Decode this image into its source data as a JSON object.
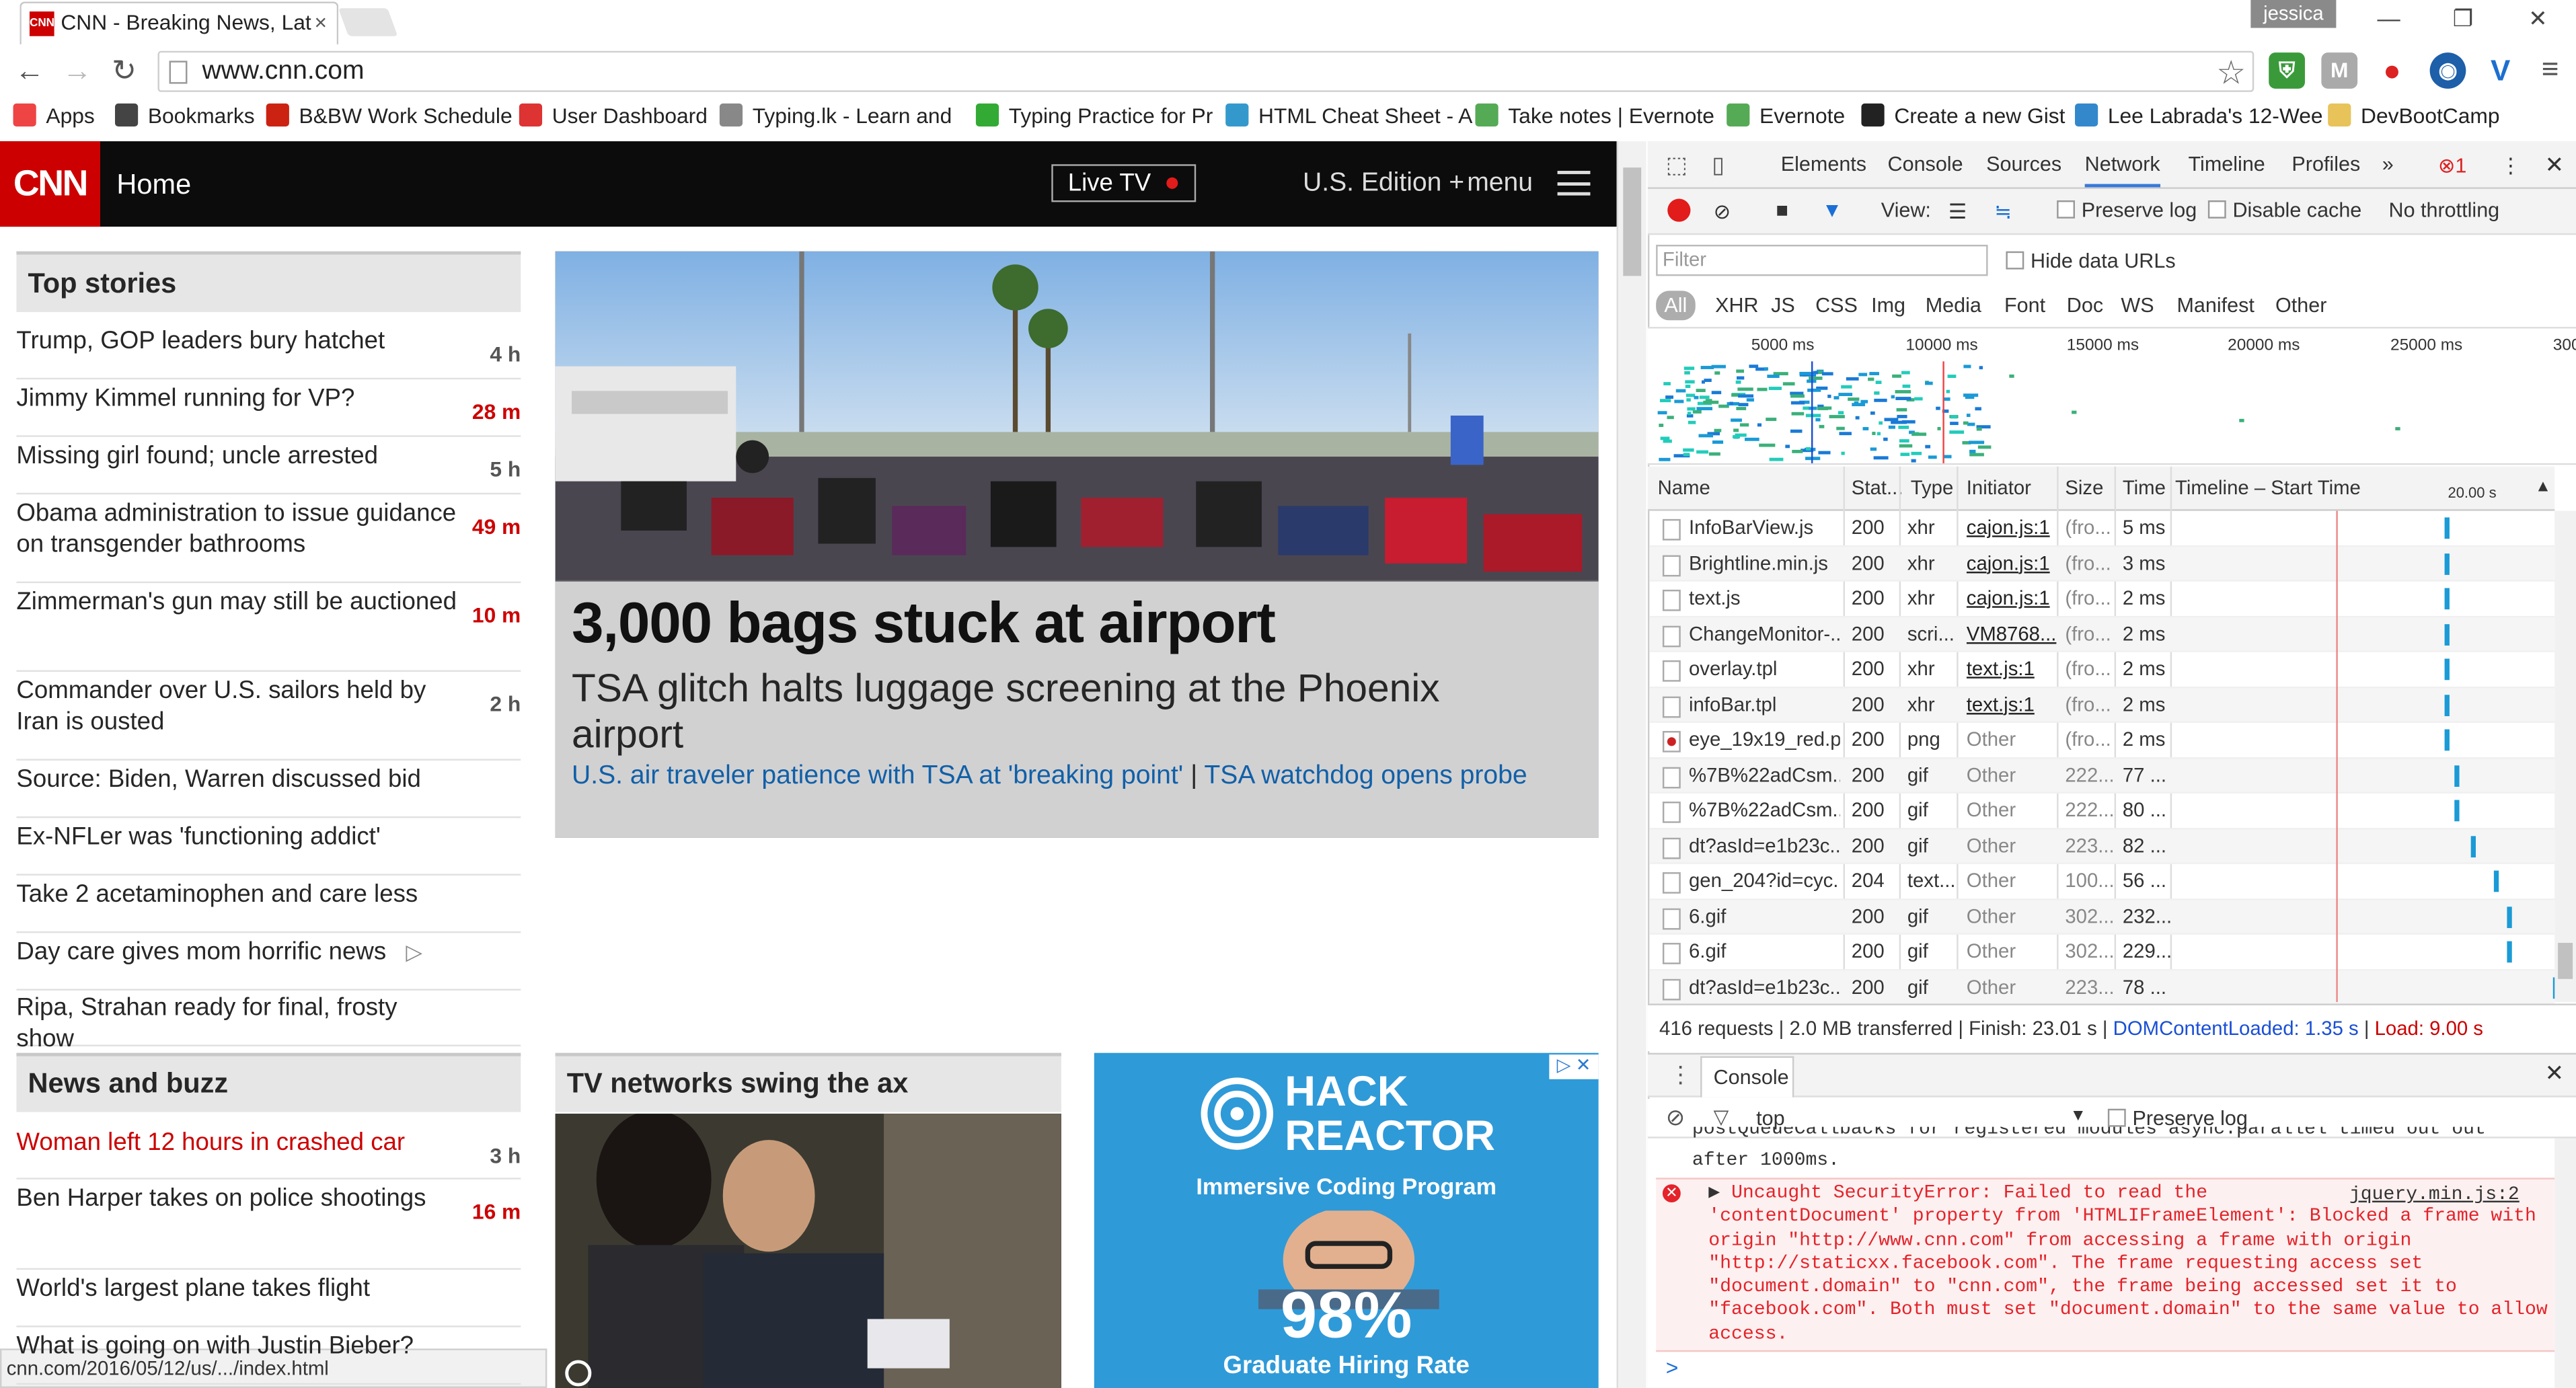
{
  "browser": {
    "tab_title": "CNN - Breaking News, Lat",
    "tab_favicon": "CNN",
    "profile": "jessica",
    "url": "www.cnn.com",
    "status_url": "cnn.com/2016/05/12/us/.../index.html"
  },
  "bookmarks": [
    {
      "label": "Apps",
      "icon": "apps-grid-icon",
      "color": "#e44"
    },
    {
      "label": "Bookmarks",
      "icon": "star-icon",
      "color": "#444"
    },
    {
      "label": "B&BW Work Schedule",
      "icon": "calendar-icon",
      "color": "#c21"
    },
    {
      "label": "User Dashboard",
      "icon": "dashboard-icon",
      "color": "#d33"
    },
    {
      "label": "Typing.lk - Learn and",
      "icon": "keyboard-icon",
      "color": "#888"
    },
    {
      "label": "Typing Practice for Pr",
      "icon": "t-icon",
      "color": "#3a3"
    },
    {
      "label": "HTML Cheat Sheet - A",
      "icon": "code-icon",
      "color": "#39c"
    },
    {
      "label": "Take notes | Evernote",
      "icon": "evernote-icon",
      "color": "#5a5"
    },
    {
      "label": "Evernote",
      "icon": "evernote-icon",
      "color": "#5a5"
    },
    {
      "label": "Create a new Gist",
      "icon": "github-icon",
      "color": "#222"
    },
    {
      "label": "Lee Labrada's 12-Wee",
      "icon": "bookmark-icon",
      "color": "#38c"
    },
    {
      "label": "DevBootCamp",
      "icon": "folder-icon",
      "color": "#e8c35a"
    }
  ],
  "cnn": {
    "logo": "CNN",
    "home": "Home",
    "live_tv": "Live TV",
    "edition": "U.S. Edition +",
    "menu": "menu",
    "top_stories_title": "Top stories",
    "top_stories": [
      {
        "title": "Trump, GOP leaders bury hatchet",
        "time": "4 h",
        "red": false
      },
      {
        "title": "Jimmy Kimmel running for VP?",
        "time": "28 m",
        "red": true
      },
      {
        "title": "Missing girl found; uncle arrested",
        "time": "5 h",
        "red": false
      },
      {
        "title": "Obama administration to issue guidance on transgender bathrooms",
        "time": "49 m",
        "red": true
      },
      {
        "title": "Zimmerman's gun may still be auctioned",
        "time": "10 m",
        "red": true
      },
      {
        "title": "Commander over U.S. sailors held by Iran is ousted",
        "time": "2 h",
        "red": false
      },
      {
        "title": "Source: Biden, Warren discussed bid",
        "time": "",
        "red": false
      },
      {
        "title": "Ex-NFLer was 'functioning addict'",
        "time": "",
        "red": false
      },
      {
        "title": "Take 2 acetaminophen and care less",
        "time": "",
        "red": false
      },
      {
        "title": "Day care gives mom horrific news",
        "time": "",
        "red": false
      },
      {
        "title": "Ripa, Strahan ready for final, frosty show",
        "time": "",
        "red": false
      }
    ],
    "hero": {
      "headline": "3,000 bags stuck at airport",
      "subhead": "TSA glitch halts luggage screening at the Phoenix airport",
      "link1": "U.S. air traveler patience with TSA at 'breaking point'",
      "separator": " | ",
      "link2": "TSA watchdog opens probe"
    },
    "news_buzz_title": "News and buzz",
    "news_buzz": [
      {
        "title": "Woman left 12 hours in crashed car",
        "time": "3 h",
        "red": false,
        "title_red": true
      },
      {
        "title": "Ben Harper takes on police shootings",
        "time": "16 m",
        "red": true,
        "title_red": false
      },
      {
        "title": "World's largest plane takes flight",
        "time": "",
        "red": false,
        "title_red": false
      },
      {
        "title": "What is going on with Justin Bieber?",
        "time": "",
        "red": false,
        "title_red": false
      }
    ],
    "tv_section": "TV networks swing the ax",
    "ad": {
      "brand1": "HACK",
      "brand2": "REACTOR",
      "line": "Immersive Coding Program",
      "percent": "98%",
      "bottom": "Graduate Hiring Rate"
    }
  },
  "devtools": {
    "tabs": [
      "Elements",
      "Console",
      "Sources",
      "Network",
      "Timeline",
      "Profiles"
    ],
    "active_tab": "Network",
    "more": "»",
    "error_count": "1",
    "toolbar": {
      "view": "View:",
      "preserve_log": "Preserve log",
      "disable_cache": "Disable cache",
      "throttling": "No throttling"
    },
    "filter_placeholder": "Filter",
    "hide_data_urls": "Hide data URLs",
    "filter_types": [
      "All",
      "XHR",
      "JS",
      "CSS",
      "Img",
      "Media",
      "Font",
      "Doc",
      "WS",
      "Manifest",
      "Other"
    ],
    "overview_ticks": [
      "5000 ms",
      "10000 ms",
      "15000 ms",
      "20000 ms",
      "25000 ms",
      "300"
    ],
    "columns": {
      "name": "Name",
      "status": "Stat...",
      "type": "Type",
      "initiator": "Initiator",
      "size": "Size",
      "time": "Time",
      "timeline": "Timeline – Start Time",
      "timeline_tick": "20.00 s"
    },
    "requests": [
      {
        "name": "InfoBarView.js",
        "status": "200",
        "type": "xhr",
        "initiator": "cajon.js:1",
        "link": true,
        "size": "(fro...",
        "time": "5 ms",
        "start": 0.55
      },
      {
        "name": "Brightline.min.js",
        "status": "200",
        "type": "xhr",
        "initiator": "cajon.js:1",
        "link": true,
        "size": "(fro...",
        "time": "3 ms",
        "start": 0.55
      },
      {
        "name": "text.js",
        "status": "200",
        "type": "xhr",
        "initiator": "cajon.js:1",
        "link": true,
        "size": "(fro...",
        "time": "2 ms",
        "start": 0.55
      },
      {
        "name": "ChangeMonitor-...",
        "status": "200",
        "type": "scri...",
        "initiator": "VM8768...",
        "link": true,
        "size": "(fro...",
        "time": "2 ms",
        "start": 0.55
      },
      {
        "name": "overlay.tpl",
        "status": "200",
        "type": "xhr",
        "initiator": "text.js:1",
        "link": true,
        "size": "(fro...",
        "time": "2 ms",
        "start": 0.55
      },
      {
        "name": "infoBar.tpl",
        "status": "200",
        "type": "xhr",
        "initiator": "text.js:1",
        "link": true,
        "size": "(fro...",
        "time": "2 ms",
        "start": 0.55
      },
      {
        "name": "eye_19x19_red.p...",
        "status": "200",
        "type": "png",
        "initiator": "Other",
        "link": false,
        "size": "(fro...",
        "time": "2 ms",
        "start": 0.55
      },
      {
        "name": "%7B%22adCsm...",
        "status": "200",
        "type": "gif",
        "initiator": "Other",
        "link": false,
        "size": "222...",
        "time": "77 ...",
        "start": 0.6
      },
      {
        "name": "%7B%22adCsm...",
        "status": "200",
        "type": "gif",
        "initiator": "Other",
        "link": false,
        "size": "222...",
        "time": "80 ...",
        "start": 0.6
      },
      {
        "name": "dt?asId=e1b23c...",
        "status": "200",
        "type": "gif",
        "initiator": "Other",
        "link": false,
        "size": "223...",
        "time": "82 ...",
        "start": 0.68
      },
      {
        "name": "gen_204?id=cyc...",
        "status": "204",
        "type": "text...",
        "initiator": "Other",
        "link": false,
        "size": "100...",
        "time": "56 ...",
        "start": 0.8
      },
      {
        "name": "6.gif",
        "status": "200",
        "type": "gif",
        "initiator": "Other",
        "link": false,
        "size": "302...",
        "time": "232...",
        "start": 0.87
      },
      {
        "name": "6.gif",
        "status": "200",
        "type": "gif",
        "initiator": "Other",
        "link": false,
        "size": "302...",
        "time": "229...",
        "start": 0.87
      },
      {
        "name": "dt?asId=e1b23c...",
        "status": "200",
        "type": "gif",
        "initiator": "Other",
        "link": false,
        "size": "223...",
        "time": "78 ...",
        "start": 1.1
      }
    ],
    "summary": {
      "requests": "416 requests",
      "transferred": "2.0 MB transferred",
      "finish": "Finish: 23.01 s",
      "dcl": "DOMContentLoaded: 1.35 s",
      "load": "Load: 9.00 s"
    },
    "console": {
      "title": "Console",
      "context": "top",
      "preserve_log": "Preserve log",
      "prev_line1": "postQueueCallbacks for registered modules async.parallel timed out out",
      "prev_line2": "after 1000ms.",
      "error": "Uncaught SecurityError: Failed to read the\n'contentDocument' property from 'HTMLIFrameElement': Blocked a frame with\norigin \"http://www.cnn.com\" from accessing a frame with origin\n\"http://staticxx.facebook.com\". The frame requesting access set\n\"document.domain\" to \"cnn.com\", the frame being accessed set it to\n\"facebook.com\". Both must set \"document.domain\" to the same value to allow\naccess.",
      "error_source": "jquery.min.js:2",
      "prompt": ">"
    }
  }
}
